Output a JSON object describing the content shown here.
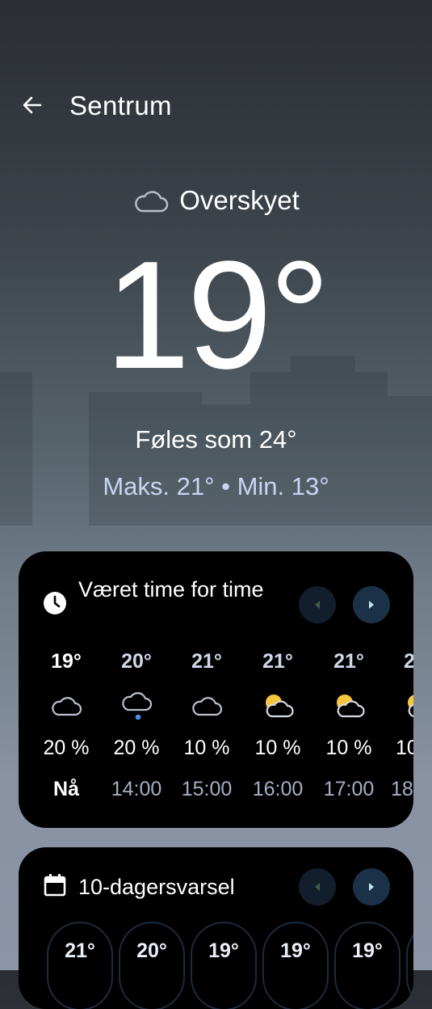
{
  "header": {
    "title": "Sentrum",
    "back_icon": "arrow-left-icon"
  },
  "current": {
    "condition": "Overskyet",
    "condition_icon": "cloud-icon",
    "temperature": "19°",
    "feels_like": "Føles som 24°",
    "max_min": "Maks. 21° • Min. 13°"
  },
  "hourly": {
    "title": "Været time for time",
    "icon": "clock-icon",
    "prev_icon": "chevron-left-icon",
    "next_icon": "chevron-right-icon",
    "items": [
      {
        "temp": "19°",
        "icon": "cloud-icon",
        "precip": "20 %",
        "time": "Nå"
      },
      {
        "temp": "20°",
        "icon": "cloud-rain-icon",
        "precip": "20 %",
        "time": "14:00"
      },
      {
        "temp": "21°",
        "icon": "cloud-icon",
        "precip": "10 %",
        "time": "15:00"
      },
      {
        "temp": "21°",
        "icon": "partly-cloudy-icon",
        "precip": "10 %",
        "time": "16:00"
      },
      {
        "temp": "21°",
        "icon": "partly-cloudy-icon",
        "precip": "10 %",
        "time": "17:00"
      },
      {
        "temp": "2",
        "icon": "partly-cloudy-icon",
        "precip": "10",
        "time": "18"
      }
    ]
  },
  "daily": {
    "title": "10-dagersvarsel",
    "icon": "calendar-icon",
    "prev_icon": "chevron-left-icon",
    "next_icon": "chevron-right-icon",
    "items": [
      {
        "temp": "21°"
      },
      {
        "temp": "20°"
      },
      {
        "temp": "19°"
      },
      {
        "temp": "19°"
      },
      {
        "temp": "19°"
      },
      {
        "temp": ""
      }
    ]
  },
  "colors": {
    "accent_rain": "#4a90e2",
    "sun": "#f6c53d",
    "secondary_text": "#c9d6f3"
  }
}
